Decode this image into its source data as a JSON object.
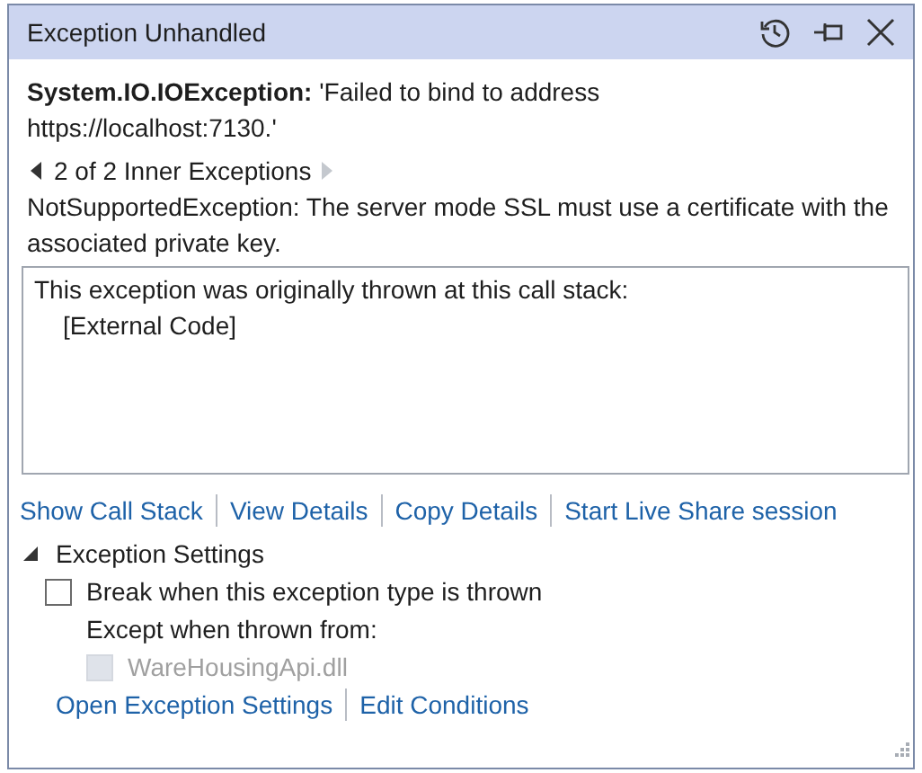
{
  "window": {
    "title": "Exception Unhandled"
  },
  "message": "**System.IO.IOException:** 'Failed to bind to address https://localhost:7130.'",
  "inner_nav": {
    "label": "2 of 2 Inner Exceptions",
    "prev_disabled": false,
    "next_disabled": true
  },
  "inner_exception": "NotSupportedException: The server mode SSL must use a certificate with the associated private key.",
  "call_stack": {
    "heading": "This exception was originally thrown at this call stack:",
    "frames": [
      "[External Code]"
    ]
  },
  "links": [
    "Show Call Stack",
    "View Details",
    "Copy Details",
    "Start Live Share session"
  ],
  "settings": {
    "label": "Exception Settings",
    "expanded": true,
    "break_checkbox": {
      "label": "Break when this exception type is thrown",
      "checked": false
    },
    "except_label": "Except when thrown from:",
    "modules": [
      {
        "label": "WareHousingApi.dll",
        "checked": false,
        "disabled": true
      }
    ],
    "links": [
      "Open Exception Settings",
      "Edit Conditions"
    ]
  }
}
